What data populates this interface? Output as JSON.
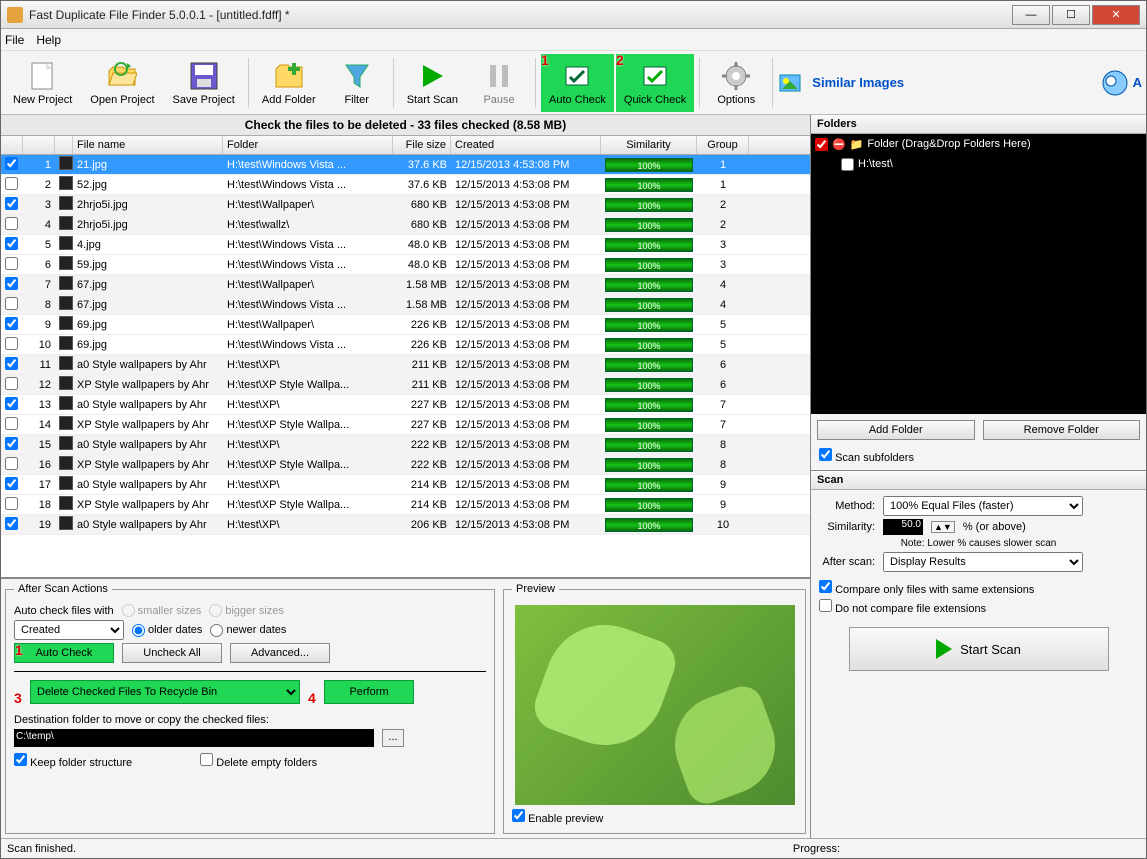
{
  "window": {
    "title": "Fast Duplicate File Finder 5.0.0.1 - [untitled.fdff] *"
  },
  "menu": {
    "file": "File",
    "help": "Help"
  },
  "toolbar": {
    "new_project": "New Project",
    "open_project": "Open Project",
    "save_project": "Save Project",
    "add_folder": "Add Folder",
    "filter": "Filter",
    "start_scan": "Start Scan",
    "pause": "Pause",
    "auto_check": "Auto Check",
    "quick_check": "Quick Check",
    "options": "Options",
    "similar_images": "Similar Images",
    "a": "A"
  },
  "list_header": "Check the files to be deleted - 33 files checked (8.58 MB)",
  "columns": {
    "file_name": "File name",
    "folder": "Folder",
    "file_size": "File size",
    "created": "Created",
    "similarity": "Similarity",
    "group": "Group"
  },
  "rows": [
    {
      "chk": true,
      "n": 1,
      "name": "21.jpg",
      "folder": "H:\\test\\Windows Vista ...",
      "size": "37.6 KB",
      "date": "12/15/2013 4:53:08 PM",
      "sim": "100%",
      "grp": 1,
      "sel": true
    },
    {
      "chk": false,
      "n": 2,
      "name": "52.jpg",
      "folder": "H:\\test\\Windows Vista ...",
      "size": "37.6 KB",
      "date": "12/15/2013 4:53:08 PM",
      "sim": "100%",
      "grp": 1
    },
    {
      "chk": true,
      "n": 3,
      "name": "2hrjo5i.jpg",
      "folder": "H:\\test\\Wallpaper\\",
      "size": "680 KB",
      "date": "12/15/2013 4:53:08 PM",
      "sim": "100%",
      "grp": 2,
      "alt": true
    },
    {
      "chk": false,
      "n": 4,
      "name": "2hrjo5i.jpg",
      "folder": "H:\\test\\wallz\\",
      "size": "680 KB",
      "date": "12/15/2013 4:53:08 PM",
      "sim": "100%",
      "grp": 2,
      "alt": true
    },
    {
      "chk": true,
      "n": 5,
      "name": "4.jpg",
      "folder": "H:\\test\\Windows Vista ...",
      "size": "48.0 KB",
      "date": "12/15/2013 4:53:08 PM",
      "sim": "100%",
      "grp": 3
    },
    {
      "chk": false,
      "n": 6,
      "name": "59.jpg",
      "folder": "H:\\test\\Windows Vista ...",
      "size": "48.0 KB",
      "date": "12/15/2013 4:53:08 PM",
      "sim": "100%",
      "grp": 3
    },
    {
      "chk": true,
      "n": 7,
      "name": "67.jpg",
      "folder": "H:\\test\\Wallpaper\\",
      "size": "1.58 MB",
      "date": "12/15/2013 4:53:08 PM",
      "sim": "100%",
      "grp": 4,
      "alt": true
    },
    {
      "chk": false,
      "n": 8,
      "name": "67.jpg",
      "folder": "H:\\test\\Windows Vista ...",
      "size": "1.58 MB",
      "date": "12/15/2013 4:53:08 PM",
      "sim": "100%",
      "grp": 4,
      "alt": true
    },
    {
      "chk": true,
      "n": 9,
      "name": "69.jpg",
      "folder": "H:\\test\\Wallpaper\\",
      "size": "226 KB",
      "date": "12/15/2013 4:53:08 PM",
      "sim": "100%",
      "grp": 5
    },
    {
      "chk": false,
      "n": 10,
      "name": "69.jpg",
      "folder": "H:\\test\\Windows Vista ...",
      "size": "226 KB",
      "date": "12/15/2013 4:53:08 PM",
      "sim": "100%",
      "grp": 5
    },
    {
      "chk": true,
      "n": 11,
      "name": "a0 Style wallpapers by Ahr",
      "folder": "H:\\test\\XP\\",
      "size": "211 KB",
      "date": "12/15/2013 4:53:08 PM",
      "sim": "100%",
      "grp": 6,
      "alt": true
    },
    {
      "chk": false,
      "n": 12,
      "name": "XP Style wallpapers by Ahr",
      "folder": "H:\\test\\XP Style Wallpa...",
      "size": "211 KB",
      "date": "12/15/2013 4:53:08 PM",
      "sim": "100%",
      "grp": 6,
      "alt": true
    },
    {
      "chk": true,
      "n": 13,
      "name": "a0 Style wallpapers by Ahr",
      "folder": "H:\\test\\XP\\",
      "size": "227 KB",
      "date": "12/15/2013 4:53:08 PM",
      "sim": "100%",
      "grp": 7
    },
    {
      "chk": false,
      "n": 14,
      "name": "XP Style wallpapers by Ahr",
      "folder": "H:\\test\\XP Style Wallpa...",
      "size": "227 KB",
      "date": "12/15/2013 4:53:08 PM",
      "sim": "100%",
      "grp": 7
    },
    {
      "chk": true,
      "n": 15,
      "name": "a0 Style wallpapers by Ahr",
      "folder": "H:\\test\\XP\\",
      "size": "222 KB",
      "date": "12/15/2013 4:53:08 PM",
      "sim": "100%",
      "grp": 8,
      "alt": true
    },
    {
      "chk": false,
      "n": 16,
      "name": "XP Style wallpapers by Ahr",
      "folder": "H:\\test\\XP Style Wallpa...",
      "size": "222 KB",
      "date": "12/15/2013 4:53:08 PM",
      "sim": "100%",
      "grp": 8,
      "alt": true
    },
    {
      "chk": true,
      "n": 17,
      "name": "a0 Style wallpapers by Ahr",
      "folder": "H:\\test\\XP\\",
      "size": "214 KB",
      "date": "12/15/2013 4:53:08 PM",
      "sim": "100%",
      "grp": 9
    },
    {
      "chk": false,
      "n": 18,
      "name": "XP Style wallpapers by Ahr",
      "folder": "H:\\test\\XP Style Wallpa...",
      "size": "214 KB",
      "date": "12/15/2013 4:53:08 PM",
      "sim": "100%",
      "grp": 9
    },
    {
      "chk": true,
      "n": 19,
      "name": "a0 Style wallpapers by Ahr",
      "folder": "H:\\test\\XP\\",
      "size": "206 KB",
      "date": "12/15/2013 4:53:08 PM",
      "sim": "100%",
      "grp": 10,
      "alt": true
    }
  ],
  "after_scan": {
    "legend": "After Scan Actions",
    "auto_check_label": "Auto check files with",
    "smaller": "smaller sizes",
    "bigger": "bigger sizes",
    "older": "older dates",
    "newer": "newer dates",
    "dropdown": "Created",
    "auto_check_btn": "Auto Check",
    "uncheck_all": "Uncheck All",
    "advanced": "Advanced...",
    "action_sel": "Delete Checked Files To Recycle Bin",
    "perform": "Perform",
    "dest_label": "Destination folder to move or copy the checked files:",
    "dest_value": "C:\\temp\\",
    "keep_structure": "Keep folder structure",
    "delete_empty": "Delete empty folders"
  },
  "preview": {
    "legend": "Preview",
    "enable": "Enable preview"
  },
  "folders": {
    "head": "Folders",
    "root": "Folder (Drag&Drop Folders Here)",
    "item": "H:\\test\\",
    "add": "Add Folder",
    "remove": "Remove Folder",
    "scan_sub": "Scan subfolders"
  },
  "scan": {
    "head": "Scan",
    "method_lbl": "Method:",
    "method": "100% Equal Files (faster)",
    "sim_lbl": "Similarity:",
    "sim_val": "50.0",
    "sim_suffix": "%  (or above)",
    "note": "Note: Lower % causes slower scan",
    "after_lbl": "After scan:",
    "after": "Display Results",
    "compare_ext": "Compare only files with same extensions",
    "no_compare_ext": "Do not compare file extensions",
    "start": "Start Scan"
  },
  "status": {
    "msg": "Scan finished.",
    "progress": "Progress:"
  }
}
